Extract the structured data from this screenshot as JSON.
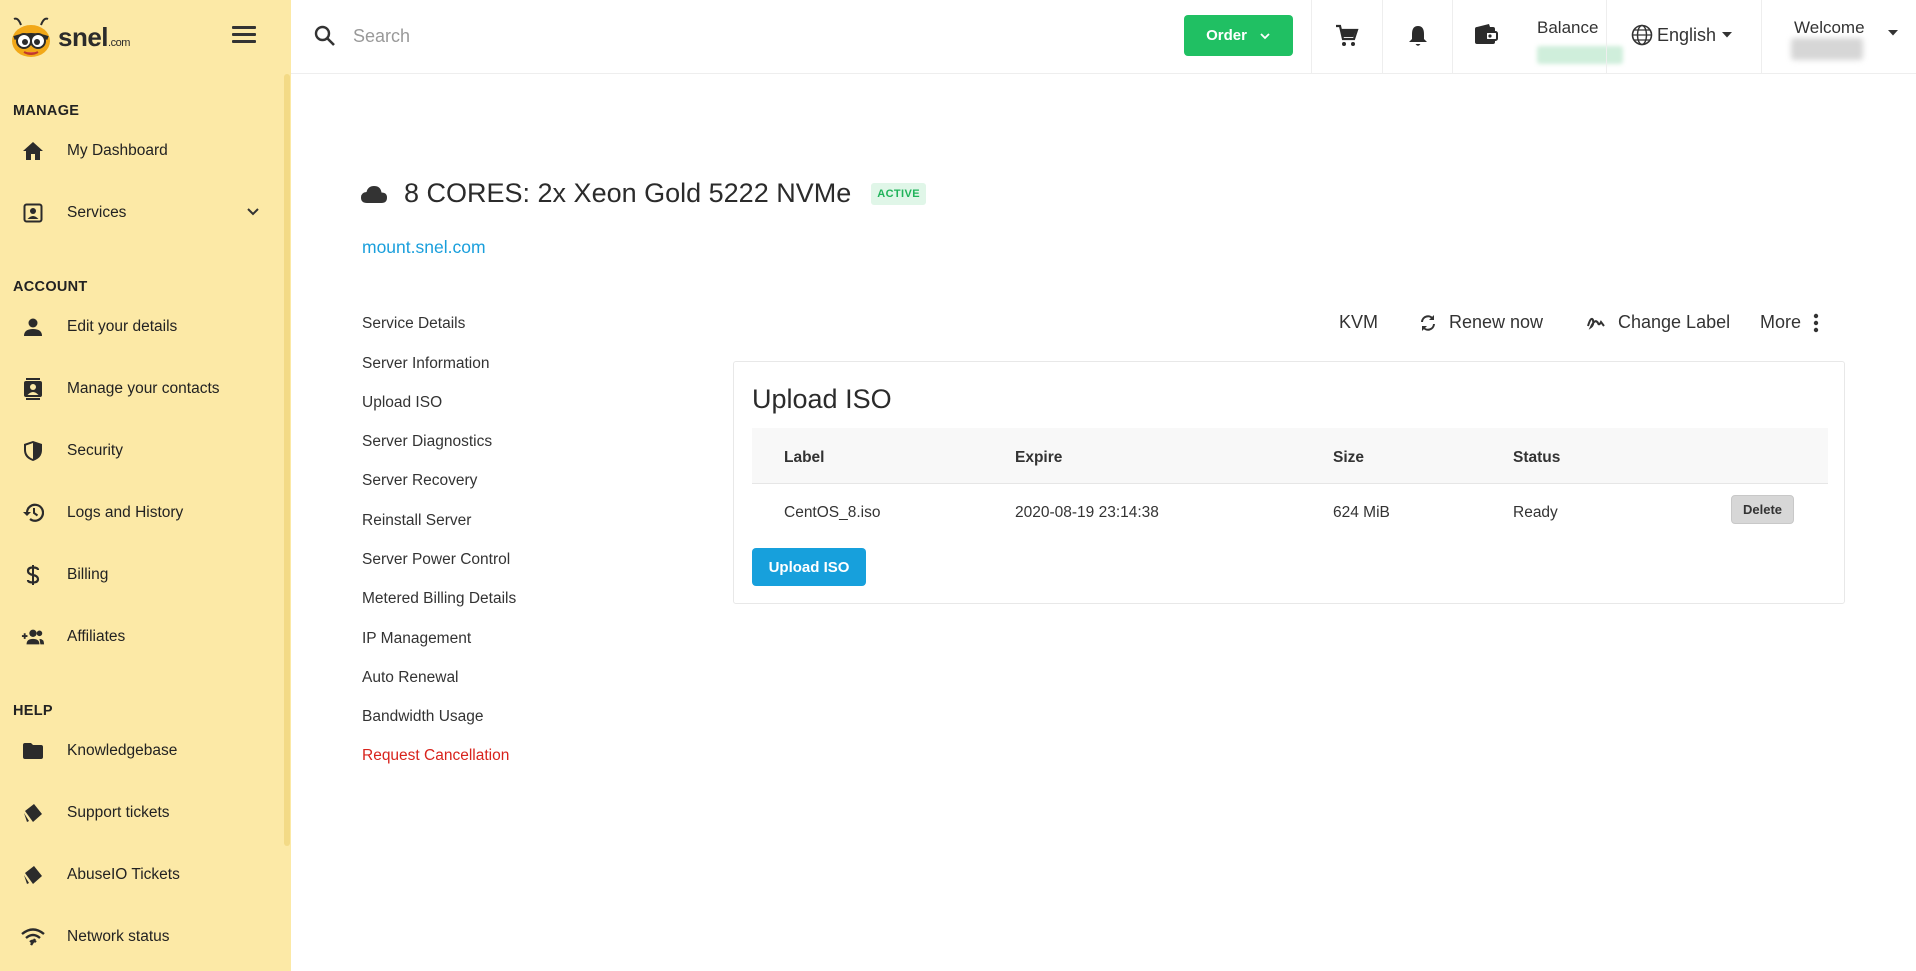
{
  "brand": {
    "name": "snel",
    "tld": ".com"
  },
  "topbar": {
    "search_placeholder": "Search",
    "order_label": "Order",
    "balance_label": "Balance",
    "language": "English",
    "welcome_label": "Welcome"
  },
  "sidebar": {
    "manage_heading": "MANAGE",
    "account_heading": "ACCOUNT",
    "help_heading": "HELP",
    "items": {
      "dashboard": "My Dashboard",
      "services": "Services",
      "edit_details": "Edit your details",
      "contacts": "Manage your contacts",
      "security": "Security",
      "logs": "Logs and History",
      "billing": "Billing",
      "affiliates": "Affiliates",
      "knowledgebase": "Knowledgebase",
      "support": "Support tickets",
      "abuseio": "AbuseIO Tickets",
      "network": "Network status"
    }
  },
  "service": {
    "title": "8 CORES: 2x Xeon Gold 5222 NVMe",
    "status_badge": "ACTIVE",
    "hostname": "mount.snel.com"
  },
  "submenu": [
    "Service Details",
    "Server Information",
    "Upload ISO",
    "Server Diagnostics",
    "Server Recovery",
    "Reinstall Server",
    "Server Power Control",
    "Metered Billing Details",
    "IP Management",
    "Auto Renewal",
    "Bandwidth Usage",
    "Request Cancellation"
  ],
  "actions": {
    "kvm": "KVM",
    "renew": "Renew now",
    "change_label": "Change Label",
    "more": "More"
  },
  "iso_card": {
    "title": "Upload ISO",
    "columns": {
      "label": "Label",
      "expire": "Expire",
      "size": "Size",
      "status": "Status"
    },
    "rows": [
      {
        "label": "CentOS_8.iso",
        "expire": "2020-08-19 23:14:38",
        "size": "624 MiB",
        "status": "Ready",
        "delete": "Delete"
      }
    ],
    "upload_button": "Upload ISO"
  },
  "colors": {
    "sidebar_bg": "#fce9a6",
    "order_green": "#20c063",
    "link_blue": "#1a9fdc",
    "danger_red": "#d8231c",
    "badge_green": "#20b35a"
  }
}
